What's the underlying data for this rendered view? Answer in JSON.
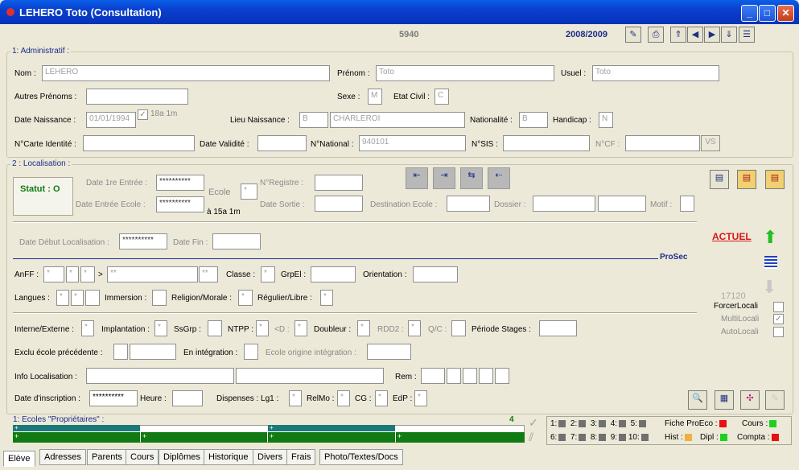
{
  "window": {
    "title": "LEHERO Toto (Consultation)",
    "minimize": "_",
    "maximize": "□",
    "close": "✕"
  },
  "header": {
    "record_id": "5940",
    "year": "2008/2009"
  },
  "admin": {
    "section": "1: Administratif :",
    "nom_label": "Nom :",
    "nom": "LEHERO",
    "prenom_label": "Prénom :",
    "prenom": "Toto",
    "usuel_label": "Usuel :",
    "usuel": "Toto",
    "autres_prenoms_label": "Autres Prénoms :",
    "sexe_label": "Sexe :",
    "sexe": "M",
    "etat_civil_label": "Etat Civil :",
    "etat_civil": "C",
    "date_naissance_label": "Date Naissance :",
    "date_naissance": "01/01/1994",
    "age": "18a 1m",
    "lieu_naissance_label": "Lieu Naissance :",
    "lieu_code": "B",
    "lieu": "CHARLEROI",
    "nationalite_label": "Nationalité :",
    "nationalite": "B",
    "handicap_label": "Handicap :",
    "handicap": "N",
    "carte_label": "N°Carte Identité :",
    "date_validite_label": "Date Validité :",
    "national_label": "N°National :",
    "national": "940101",
    "sis_label": "N°SIS :",
    "cf_label": "N°CF :",
    "vs_button": "VS"
  },
  "loc": {
    "section": "2 : Localisation :",
    "statut": "Statut : O",
    "date_entree_label": "Date 1re Entrée :",
    "date_entree": "**********",
    "date_entree_ecole_label": "Date Entrée Ecole :",
    "date_entree_ecole": "**********",
    "ecole_label": "Ecole",
    "ecole": "*",
    "age_ecole": "à 15a 1m",
    "registre_label": "N°Registre :",
    "date_sortie_label": "Date Sortie :",
    "destination_label": "Destination Ecole :",
    "dossier_label": "Dossier :",
    "motif_label": "Motif :",
    "date_debut_label": "Date Début Localisation :",
    "date_debut": "**********",
    "date_fin_label": "Date Fin :",
    "actuel": "ACTUEL",
    "prosec": "ProSec",
    "anff_label": "AnFF :",
    "anff": [
      "*",
      "*",
      "*"
    ],
    "anff2": "**",
    "anff3": "**",
    "gt": ">",
    "classe_label": "Classe :",
    "classe": "*",
    "grpel_label": "GrpEl :",
    "orientation_label": "Orientation :",
    "langues_label": "Langues :",
    "langues": [
      "*",
      "*",
      ""
    ],
    "immersion_label": "Immersion :",
    "religion_label": "Religion/Morale :",
    "religion": "*",
    "regulier_label": "Régulier/Libre :",
    "regulier": "*",
    "number": "17120",
    "forcer_label": "ForcerLocali",
    "multi_label": "MultiLocali",
    "multi_check": "✓",
    "auto_label": "AutoLocali",
    "interne_label": "Interne/Externe :",
    "interne": "*",
    "implantation_label": "Implantation :",
    "implantation": "*",
    "ssgrp_label": "SsGrp :",
    "ntpp_label": "NTPP :",
    "ntpp": "*",
    "lt_d_label": "<D :",
    "lt_d": "*",
    "doubleur_label": "Doubleur :",
    "doubleur": "*",
    "rdd2_label": "RDD2 :",
    "rdd2": "*",
    "qc_label": "Q/C :",
    "periode_label": "Période Stages :",
    "exclu_label": "Exclu école précédente :",
    "integration_label": "En intégration :",
    "ecole_origine_label": "Ecole origine intégration :",
    "info_label": "Info Localisation :",
    "rem_label": "Rem :",
    "inscription_label": "Date d'inscription :",
    "inscription": "**********",
    "heure_label": "Heure :",
    "dispenses_label": "Dispenses : Lg1 :",
    "lg1": "*",
    "relmo_label": "RelMo :",
    "relmo": "*",
    "cg_label": "CG :",
    "cg": "*",
    "edp_label": "EdP :",
    "edp": "*"
  },
  "ecoles": {
    "title": "1: Ecoles \"Propriétaires\" :",
    "count": "4",
    "plus": "+"
  },
  "legend": {
    "r1": [
      "1:",
      "2:",
      "3:",
      "4:",
      "5:"
    ],
    "r2": [
      "6:",
      "7:",
      "8:",
      "9:",
      "10:"
    ],
    "fiche": "Fiche ProEco :",
    "cours": "Cours :",
    "hist": "Hist :",
    "dipl": "Dipl :",
    "compta": "Compta :"
  },
  "colors": {
    "red": "#e81010",
    "green": "#20d020",
    "orange": "#f0b040",
    "darkgreen": "#127a12",
    "teal": "#1b7a78",
    "gray": "#707070",
    "actuel": "#d81818",
    "title": "#1b2d8a"
  },
  "tabs": [
    "Elève",
    "Adresses",
    "Parents",
    "Cours",
    "Diplômes",
    "Historique",
    "Divers",
    "Frais",
    "Photo/Textes/Docs"
  ]
}
